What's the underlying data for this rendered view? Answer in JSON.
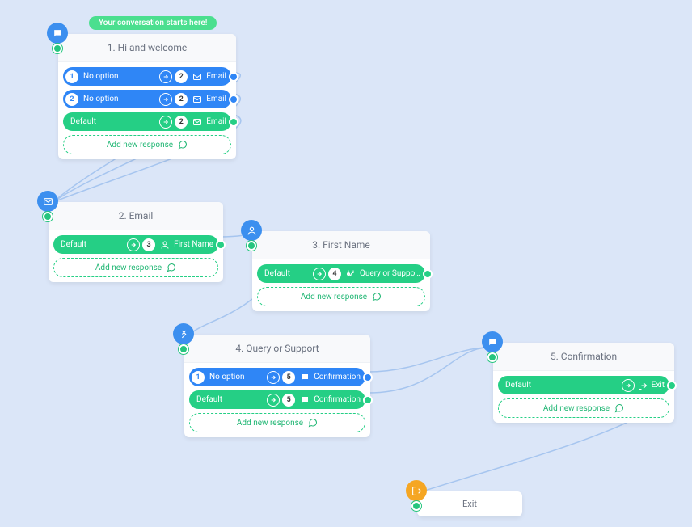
{
  "start_badge": "Your conversation starts here!",
  "add_response_label": "Add new response",
  "nodes": {
    "n1": {
      "title": "1. Hi and welcome",
      "icon": "chat-icon",
      "rows": [
        {
          "kind": "blue",
          "badge": "1",
          "label": "No option",
          "target_num": "2",
          "target_icon": "mail",
          "target_label": "Email"
        },
        {
          "kind": "blue",
          "badge": "2",
          "label": "No option",
          "target_num": "2",
          "target_icon": "mail",
          "target_label": "Email"
        },
        {
          "kind": "green",
          "badge": "",
          "label": "Default",
          "target_num": "2",
          "target_icon": "mail",
          "target_label": "Email"
        }
      ]
    },
    "n2": {
      "title": "2. Email",
      "icon": "mail-icon",
      "rows": [
        {
          "kind": "green",
          "badge": "",
          "label": "Default",
          "target_num": "3",
          "target_icon": "user",
          "target_label": "First Name"
        }
      ]
    },
    "n3": {
      "title": "3. First Name",
      "icon": "user-icon",
      "rows": [
        {
          "kind": "green",
          "badge": "",
          "label": "Default",
          "target_num": "4",
          "target_icon": "branch",
          "target_label": "Query or Suppo…"
        }
      ]
    },
    "n4": {
      "title": "4. Query or Support",
      "icon": "branch-icon",
      "rows": [
        {
          "kind": "blue",
          "badge": "1",
          "label": "No option",
          "target_num": "5",
          "target_icon": "chat",
          "target_label": "Confirmation"
        },
        {
          "kind": "green",
          "badge": "",
          "label": "Default",
          "target_num": "5",
          "target_icon": "chat",
          "target_label": "Confirmation"
        }
      ]
    },
    "n5": {
      "title": "5. Confirmation",
      "icon": "chat-icon",
      "rows": [
        {
          "kind": "green",
          "badge": "",
          "label": "Default",
          "target_num": "",
          "target_icon": "exit",
          "target_label": "Exit"
        }
      ]
    },
    "exit": {
      "title": "Exit",
      "icon": "exit-icon"
    }
  }
}
